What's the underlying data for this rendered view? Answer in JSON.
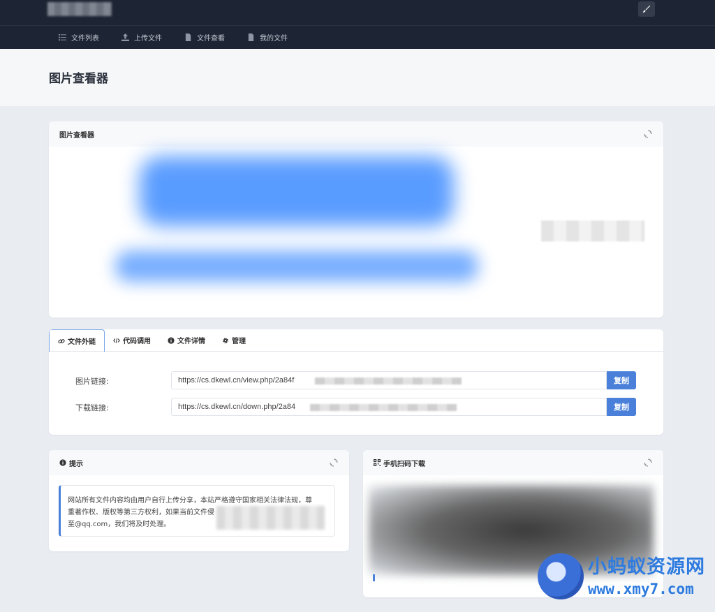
{
  "nav": {
    "items": [
      {
        "label": "文件列表",
        "icon": "list-icon"
      },
      {
        "label": "上传文件",
        "icon": "upload-icon"
      },
      {
        "label": "文件查看",
        "icon": "file-icon"
      },
      {
        "label": "我的文件",
        "icon": "file-icon"
      }
    ]
  },
  "page": {
    "title": "图片查看器"
  },
  "viewer": {
    "title": "图片查看器"
  },
  "tabs": {
    "items": [
      {
        "label": "文件外链",
        "icon": "link-icon",
        "active": true
      },
      {
        "label": "代码调用",
        "icon": "code-icon",
        "active": false
      },
      {
        "label": "文件详情",
        "icon": "info-icon",
        "active": false
      },
      {
        "label": "管理",
        "icon": "gear-icon",
        "active": false
      }
    ]
  },
  "links": {
    "image_label": "图片链接:",
    "image_url": "https://cs.dkewl.cn/view.php/2a84f",
    "download_label": "下载链接:",
    "download_url": "https://cs.dkewl.cn/down.php/2a84",
    "copy_label": "复制"
  },
  "tip": {
    "title": "提示",
    "text_line1": "网站所有文件内容均由用户自行上传分享，本站严格遵守国家相关法律法规，尊",
    "text_line2": "重著作权、版权等第三方权利，如果当前文件侵",
    "text_line3": "至@qq.com，我们将及时处理。"
  },
  "qr": {
    "title": "手机扫码下载"
  },
  "watermark": {
    "line1": "小蚂蚁资源网",
    "line2": "www.xmy7.com"
  },
  "colors": {
    "topbar": "#1d2433",
    "accent": "#4a80d9",
    "brand": "#2e7bdf"
  }
}
